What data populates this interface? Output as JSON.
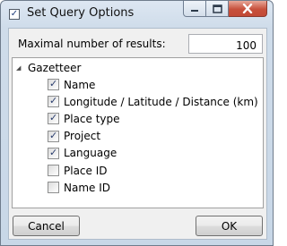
{
  "window": {
    "title": "Set Query Options",
    "title_checkbox_checked": true
  },
  "max_results": {
    "label": "Maximal number of results:",
    "value": "100"
  },
  "tree": {
    "root_label": "Gazetteer",
    "expanded": true,
    "items": [
      {
        "label": "Name",
        "checked": true
      },
      {
        "label": "Longitude / Latitude / Distance (km)",
        "checked": true
      },
      {
        "label": "Place type",
        "checked": true
      },
      {
        "label": "Project",
        "checked": true
      },
      {
        "label": "Language",
        "checked": true
      },
      {
        "label": "Place ID",
        "checked": false
      },
      {
        "label": "Name ID",
        "checked": false
      }
    ]
  },
  "buttons": {
    "cancel": "Cancel",
    "ok": "OK"
  }
}
